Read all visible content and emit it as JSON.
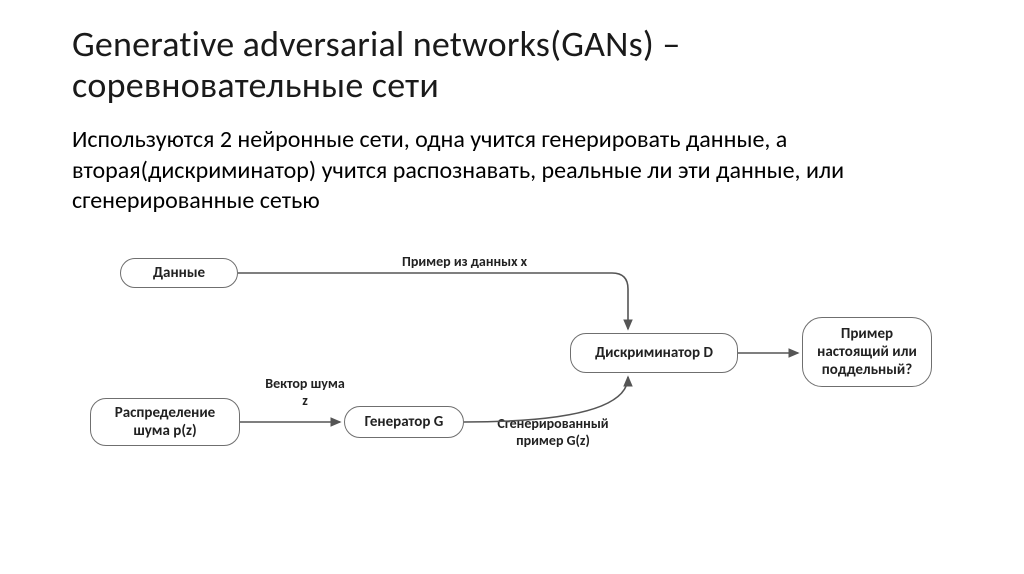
{
  "title": "Generative adversarial networks(GANs) – соревновательные сети",
  "body": "Используются 2 нейронные сети, одна учится генерировать данные, а вторая(дискриминатор) учится распознавать, реальные ли эти данные, или сгенерированные сетью",
  "diagram": {
    "boxes": {
      "data": "Данные",
      "noise": "Распределение шума p(z)",
      "generator": "Генератор G",
      "discriminator": "Дискриминатор D",
      "output": "Пример настоящий или поддельный?"
    },
    "labels": {
      "real_example": "Пример из данных x",
      "noise_vector": "Вектор шума z",
      "generated_example": "Сгенерированный пример G(z)"
    }
  }
}
